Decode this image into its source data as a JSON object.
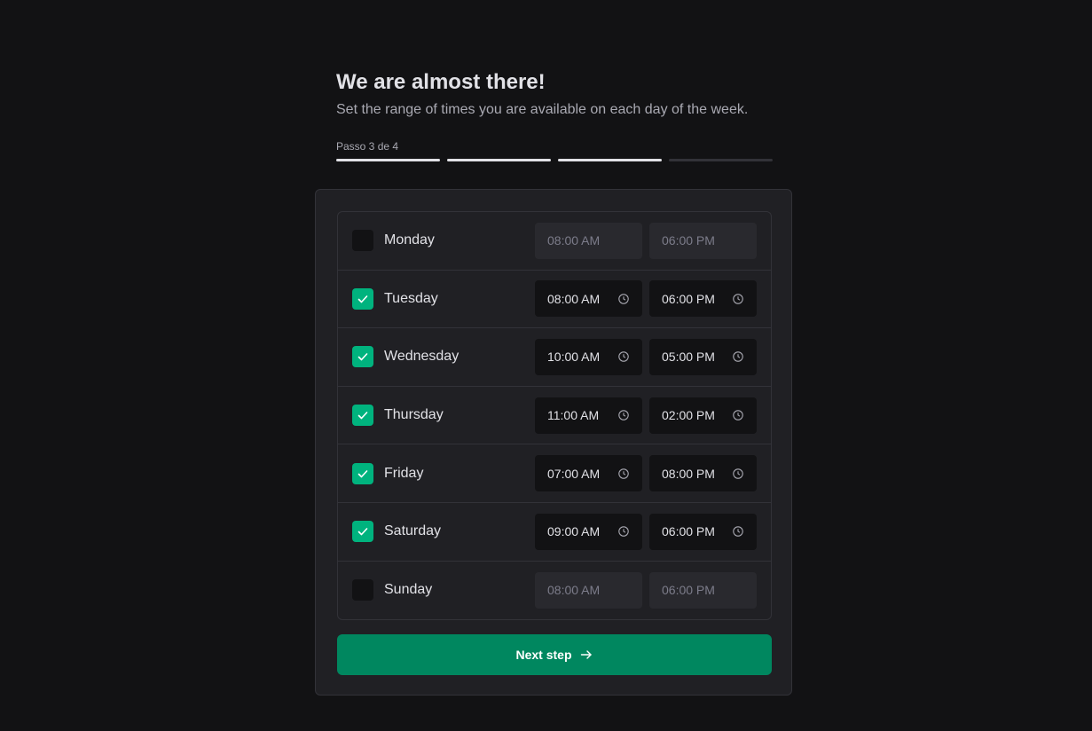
{
  "header": {
    "title": "We are almost there!",
    "subtitle": "Set the range of times you are available on each day of the week.",
    "step_label": "Passo 3 de 4",
    "steps_total": 4,
    "steps_completed": 3
  },
  "days": [
    {
      "name": "Monday",
      "enabled": false,
      "start": "08:00 AM",
      "end": "06:00 PM"
    },
    {
      "name": "Tuesday",
      "enabled": true,
      "start": "08:00 AM",
      "end": "06:00 PM"
    },
    {
      "name": "Wednesday",
      "enabled": true,
      "start": "10:00 AM",
      "end": "05:00 PM"
    },
    {
      "name": "Thursday",
      "enabled": true,
      "start": "11:00 AM",
      "end": "02:00 PM"
    },
    {
      "name": "Friday",
      "enabled": true,
      "start": "07:00 AM",
      "end": "08:00 PM"
    },
    {
      "name": "Saturday",
      "enabled": true,
      "start": "09:00 AM",
      "end": "06:00 PM"
    },
    {
      "name": "Sunday",
      "enabled": false,
      "start": "08:00 AM",
      "end": "06:00 PM"
    }
  ],
  "next_button": {
    "label": "Next step",
    "icon": "arrow-right-icon"
  },
  "colors": {
    "background": "#121214",
    "card": "#202024",
    "accent": "#00875f",
    "checkbox_checked": "#00b37e"
  }
}
